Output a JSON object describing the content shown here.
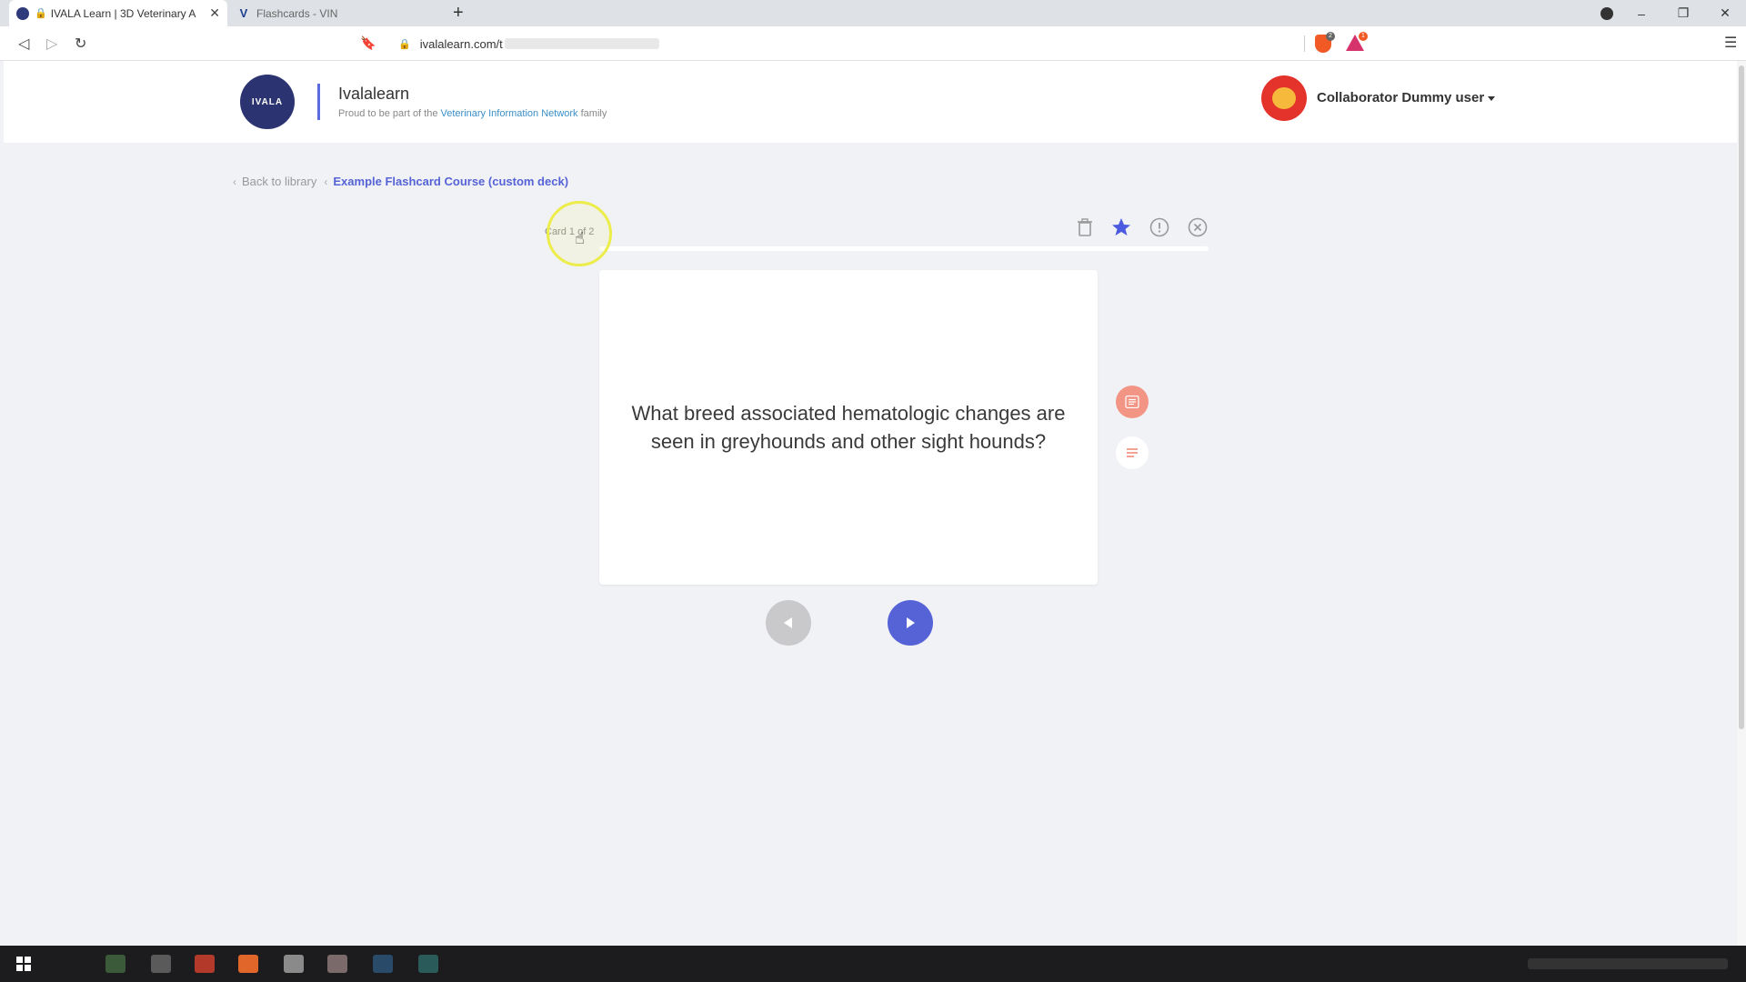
{
  "browser": {
    "tabs": [
      {
        "title": "IVALA Learn | 3D Veterinary A",
        "active": true
      },
      {
        "title": "Flashcards - VIN",
        "active": false
      }
    ],
    "new_tab": "+",
    "url": "ivalalearn.com/t",
    "window_controls": {
      "minimize": "–",
      "restore": "❐",
      "close": "✕"
    },
    "extension_badges": {
      "brave": "2",
      "rewards": "1"
    }
  },
  "header": {
    "logo_text": "IVALA",
    "brand_name": "Ivalalearn",
    "tagline_prefix": "Proud to be part of the ",
    "tagline_link": "Veterinary Information Network",
    "tagline_suffix": " family",
    "user_name": "Collaborator Dummy user"
  },
  "breadcrumb": {
    "back_label": "Back to library",
    "course_label": "Example Flashcard Course (custom deck)"
  },
  "card": {
    "counter": "Card 1 of 2",
    "progress": 0.0,
    "question": "What breed associated hematologic changes are seen in greyhounds and other sight hounds?"
  },
  "icons": {
    "delete": "trash-icon",
    "favorite": "star-icon",
    "report": "alert-circle-icon",
    "close": "close-circle-icon",
    "notes_primary": "notes-icon",
    "notes_secondary": "list-icon",
    "prev": "play-left-icon",
    "next": "play-right-icon"
  },
  "colors": {
    "accent": "#5563d6",
    "star": "#4b5be0",
    "notes_primary": "#f39585",
    "notes_secondary_icon": "#f08a7a",
    "prev_disabled": "#c9c9cc",
    "link": "#3a8fc9",
    "avatar": "#e4332b",
    "cursor_ring": "#ecec4a"
  }
}
